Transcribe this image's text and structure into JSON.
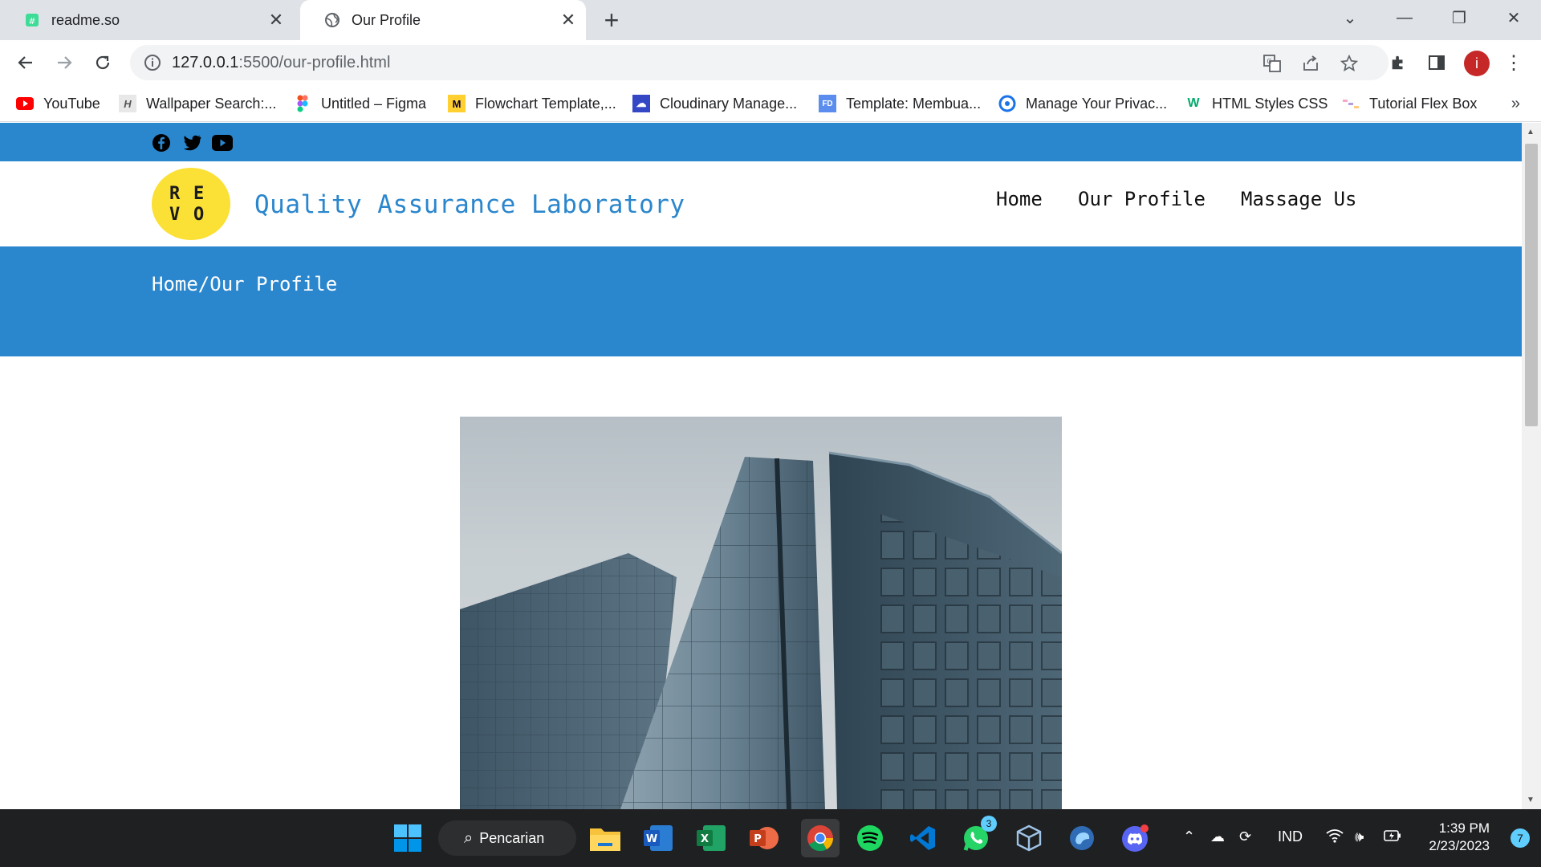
{
  "browser": {
    "tabs": [
      {
        "title": "readme.so",
        "active": false
      },
      {
        "title": "Our Profile",
        "active": true
      }
    ],
    "url_host": "127.0.0.1",
    "url_path": ":5500/our-profile.html",
    "bookmarks": [
      {
        "label": "YouTube",
        "icon": "youtube-icon"
      },
      {
        "label": "Wallpaper Search:...",
        "icon": "wallpaper-icon"
      },
      {
        "label": "Untitled – Figma",
        "icon": "figma-icon"
      },
      {
        "label": "Flowchart Template,...",
        "icon": "miro-icon"
      },
      {
        "label": "Cloudinary Manage...",
        "icon": "cloudinary-icon"
      },
      {
        "label": "Template: Membua...",
        "icon": "fd-icon"
      },
      {
        "label": "Manage Your Privac...",
        "icon": "privacy-icon"
      },
      {
        "label": "HTML Styles CSS",
        "icon": "w3schools-icon"
      },
      {
        "label": "Tutorial Flex Box",
        "icon": "flexbox-icon"
      }
    ],
    "profile_initial": "i"
  },
  "site": {
    "logo_letters": [
      "R",
      "E",
      "V",
      "O"
    ],
    "brand": "Quality Assurance Laboratory",
    "nav": [
      "Home",
      "Our Profile",
      "Massage Us"
    ],
    "breadcrumb": "Home/Our Profile",
    "social": [
      "facebook-icon",
      "twitter-icon",
      "youtube-icon"
    ],
    "colors": {
      "primary": "#2a86cd",
      "logo": "#fbe035"
    }
  },
  "taskbar": {
    "search_label": "Pencarian",
    "whatsapp_badge": "3",
    "language": "IND",
    "time": "1:39 PM",
    "date": "2/23/2023",
    "notifications": "7"
  }
}
